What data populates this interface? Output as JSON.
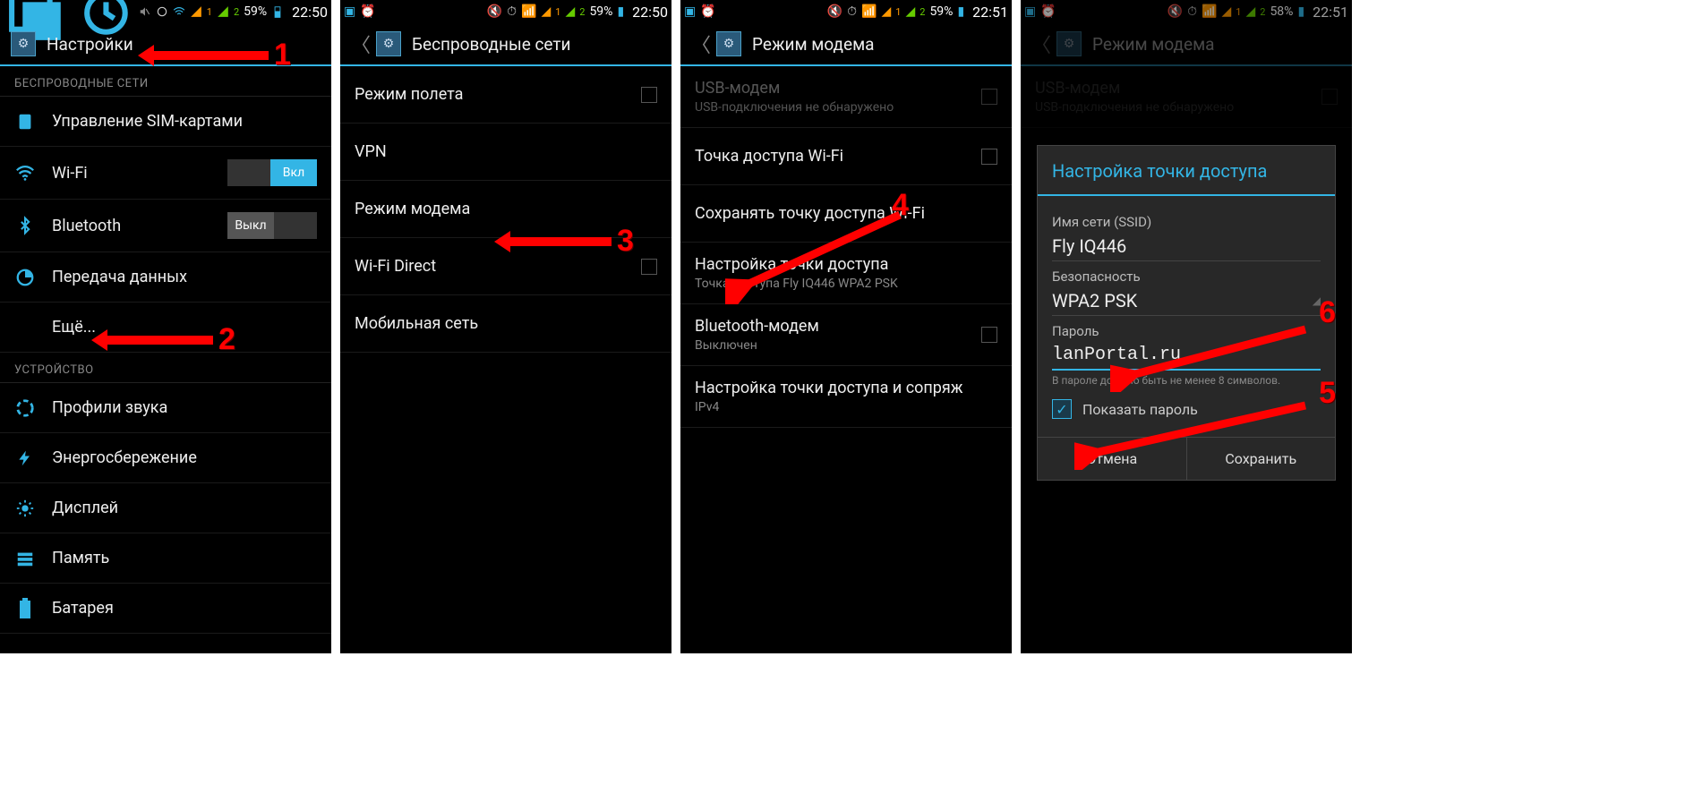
{
  "status": {
    "battery1": "59%",
    "battery2": "58%",
    "time1": "22:50",
    "time2": "22:51"
  },
  "annotations": {
    "n1": "1",
    "n2": "2",
    "n3": "3",
    "n4": "4",
    "n5": "5",
    "n6": "6"
  },
  "s1": {
    "title": "Настройки",
    "sec_wireless": "БЕСПРОВОДНЫЕ СЕТИ",
    "sim": "Управление SIM-картами",
    "wifi": "Wi-Fi",
    "wifi_state": "Вкл",
    "bt": "Bluetooth",
    "bt_state": "Выкл",
    "data": "Передача данных",
    "more": "Ещё...",
    "sec_device": "УСТРОЙСТВО",
    "audio": "Профили звука",
    "power": "Энергосбережение",
    "display": "Дисплей",
    "memory": "Память",
    "battery": "Батарея"
  },
  "s2": {
    "title": "Беспроводные сети",
    "airplane": "Режим полета",
    "vpn": "VPN",
    "tether": "Режим модема",
    "wifidirect": "Wi-Fi Direct",
    "mobile": "Мобильная сеть"
  },
  "s3": {
    "title": "Режим модема",
    "usb": "USB-модем",
    "usb_sub": "USB-подключения не обнаружено",
    "ap": "Точка доступа Wi-Fi",
    "keep": "Сохранять точку доступа Wi-Fi",
    "conf": "Настройка точки доступа",
    "conf_sub": "Точка доступа Fly IQ446 WPA2 PSK",
    "btm": "Bluetooth-модем",
    "btm_sub": "Выключен",
    "pair": "Настройка точки доступа и сопряж",
    "pair_sub": "IPv4"
  },
  "s4": {
    "title": "Режим модема",
    "usb": "USB-модем",
    "usb_sub": "USB-подключения не обнаружено",
    "dlg_title": "Настройка точки доступа",
    "ssid_label": "Имя сети (SSID)",
    "ssid_value": "Fly IQ446",
    "sec_label": "Безопасность",
    "sec_value": "WPA2 PSK",
    "pwd_label": "Пароль",
    "pwd_value": "lanPortal.ru",
    "hint": "В пароле должно быть не менее 8 символов.",
    "show_pwd": "Показать пароль",
    "cancel": "Отмена",
    "save": "Сохранить"
  }
}
